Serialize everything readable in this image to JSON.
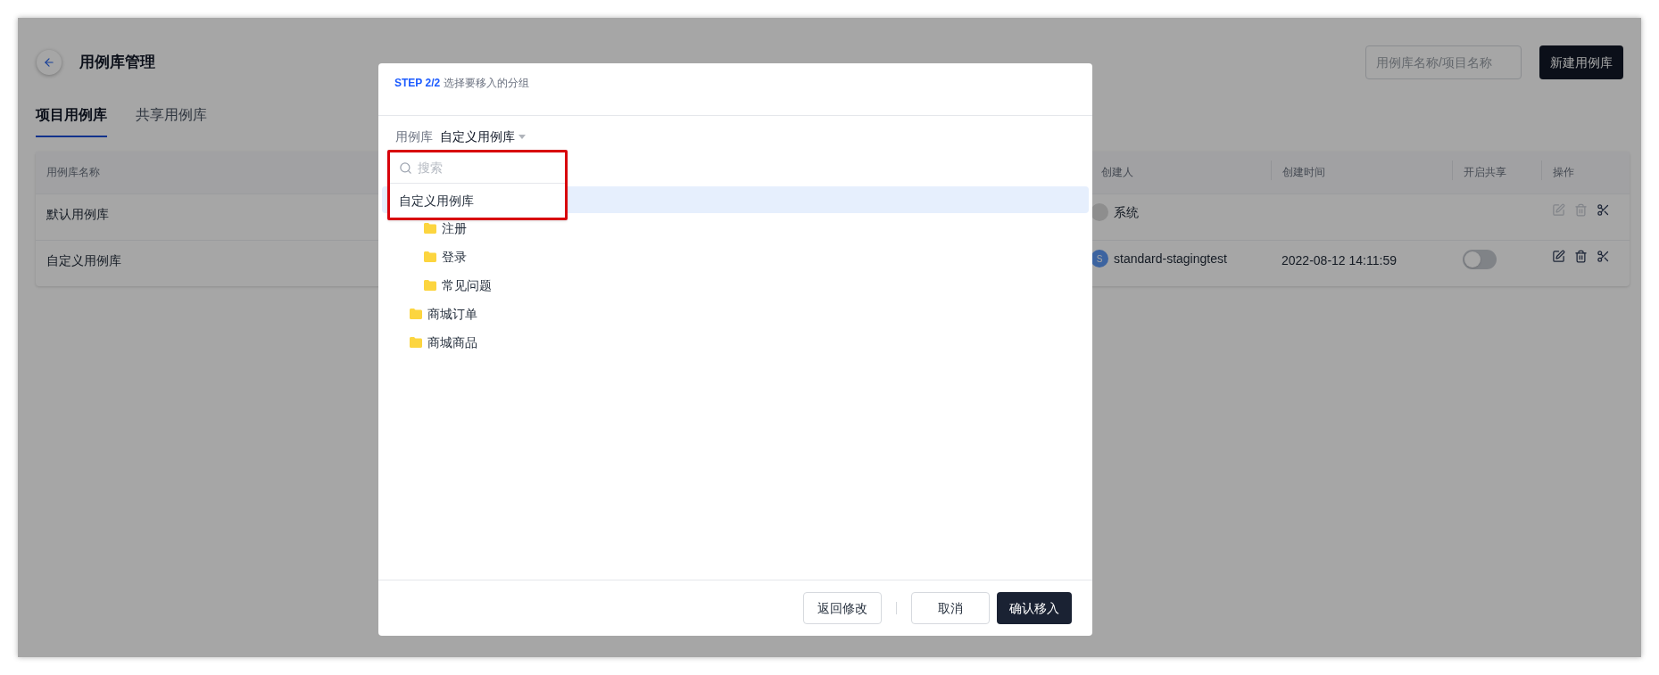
{
  "page": {
    "title": "用例库管理",
    "search": {
      "placeholder": "用例库名称/项目名称"
    },
    "new_button": "新建用例库",
    "tabs": [
      {
        "label": "项目用例库",
        "selected": true
      },
      {
        "label": "共享用例库",
        "selected": false
      }
    ]
  },
  "table": {
    "columns": [
      "用例库名称",
      "创建人",
      "创建时间",
      "开启共享",
      "操作"
    ],
    "rows": [
      {
        "name": "默认用例库",
        "creator": "系统",
        "color": "#8e8e8e",
        "actions": [
          {
            "kind": "edit",
            "disabled": true
          },
          {
            "kind": "delete",
            "disabled": true
          },
          {
            "kind": "cut",
            "disabled": false
          }
        ]
      },
      {
        "name": "自定义用例库",
        "creator": "standard-stagingtest",
        "avatar": "S",
        "color": "#3d64a0",
        "created": "2022-08-12 14:11:59",
        "shared": false,
        "actions": [
          {
            "kind": "edit",
            "disabled": false
          },
          {
            "kind": "delete",
            "disabled": false
          },
          {
            "kind": "cut",
            "disabled": false
          }
        ]
      }
    ]
  },
  "dialog": {
    "step": "STEP 2/2",
    "step_text": "选择要移入的分组",
    "library_label": "用例库",
    "library_value": "自定义用例库",
    "dropdown": {
      "search": {
        "placeholder": "搜索"
      },
      "options": [
        {
          "label": "自定义用例库",
          "selected": false
        }
      ]
    },
    "tree": [
      {
        "selected": true,
        "children": [
          {
            "label": "注册",
            "selected": false
          },
          {
            "label": "登录",
            "selected": false
          },
          {
            "label": "常见问题",
            "selected": false
          }
        ]
      },
      {
        "label": "商城订单",
        "selected": false
      },
      {
        "label": "商城商品",
        "selected": false
      }
    ],
    "buttons": [
      {
        "label": "返回修改",
        "kind": "secondary"
      },
      {
        "label": "取消",
        "kind": "secondary"
      },
      {
        "label": "确认移入",
        "kind": "primary"
      }
    ]
  }
}
